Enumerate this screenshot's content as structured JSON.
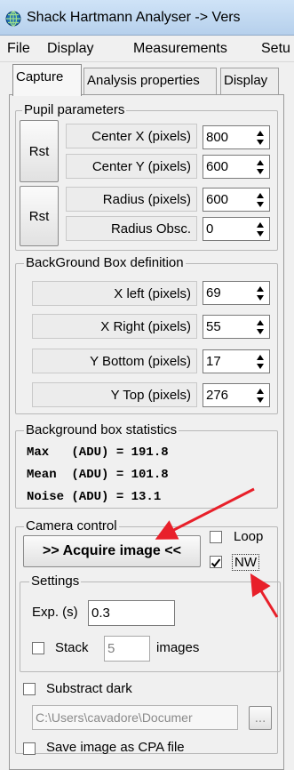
{
  "window": {
    "title": "Shack Hartmann Analyser ->  Vers",
    "icon": "globe-icon"
  },
  "menu": [
    "File",
    "Display",
    "Measurements",
    "Setu"
  ],
  "tabs": [
    "Capture",
    "Analysis properties",
    "Display"
  ],
  "pupil": {
    "title": "Pupil parameters",
    "rst_label": "Rst",
    "fields": [
      {
        "label": "Center X (pixels)",
        "value": "800"
      },
      {
        "label": "Center Y (pixels)",
        "value": "600"
      },
      {
        "label": "Radius (pixels)",
        "value": "600"
      },
      {
        "label": "Radius Obsc.",
        "value": "0"
      }
    ]
  },
  "background_box": {
    "title": "BackGround Box definition",
    "fields": [
      {
        "label": "X left (pixels)",
        "value": "69"
      },
      {
        "label": "X Right (pixels)",
        "value": "55"
      },
      {
        "label": "Y Bottom (pixels)",
        "value": "17"
      },
      {
        "label": "Y Top (pixels)",
        "value": "276"
      }
    ]
  },
  "stats": {
    "title": "Background box statistics",
    "lines": [
      "Max   (ADU) = 191.8",
      "Mean  (ADU) = 101.8",
      "Noise (ADU) = 13.1"
    ]
  },
  "camera": {
    "title": "Camera control",
    "acquire_label": ">> Acquire image <<",
    "loop_label": "Loop",
    "loop_checked": false,
    "nw_label": "NW",
    "nw_checked": true,
    "settings": {
      "title": "Settings",
      "exp_label": "Exp. (s)",
      "exp_value": "0.3",
      "stack_label": "Stack",
      "stack_value": "5",
      "stack_checked": false,
      "images_label": "images"
    },
    "subtract_dark_label": "Substract dark",
    "subtract_dark_checked": false,
    "dark_path": "C:\\Users\\cavadore\\Documer",
    "browse_label": "...",
    "save_cpa_label": "Save image as CPA file",
    "save_cpa_checked": false
  },
  "annotation_color": "#e8202a"
}
